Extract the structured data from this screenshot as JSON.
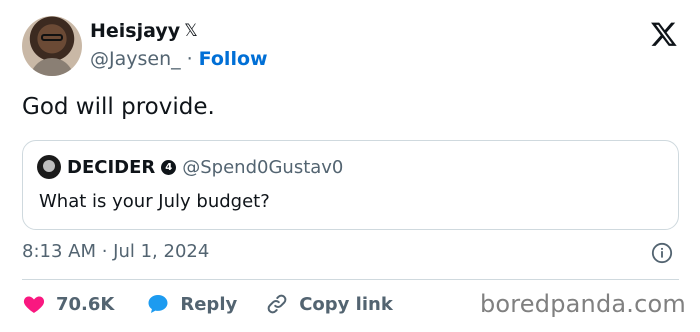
{
  "author": {
    "name": "Heisjayy",
    "name_glyphs": "𝕏",
    "handle": "@Jaysen_",
    "separator": "·",
    "follow_label": "Follow"
  },
  "tweet": {
    "text": "God will provide.",
    "timestamp": "8:13 AM · Jul 1, 2024"
  },
  "quoted": {
    "name": "DECIDER",
    "badge": "4",
    "handle": "@Spend0Gustav0",
    "text": "What is your July budget?"
  },
  "actions": {
    "likes": "70.6K",
    "reply_label": "Reply",
    "copy_label": "Copy link"
  },
  "watermark": "boredpanda.com",
  "colors": {
    "like": "#f91880",
    "reply": "#1d9bf0",
    "follow": "#006fd6",
    "muted": "#536471"
  },
  "icons": [
    "x-logo-icon",
    "info-icon",
    "heart-icon",
    "reply-bubble-icon",
    "link-icon"
  ]
}
